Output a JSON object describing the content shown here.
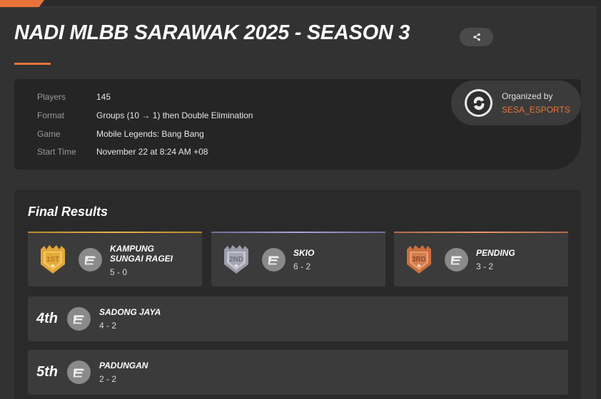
{
  "page": {
    "title": "NADI MLBB SARAWAK 2025 - SEASON 3",
    "share_icon": "share-icon"
  },
  "info": {
    "rows": [
      {
        "label": "Players",
        "value": "145"
      },
      {
        "label": "Format",
        "value": "Groups (10 → 1) then Double Elimination"
      },
      {
        "label": "Game",
        "value": "Mobile Legends: Bang Bang"
      },
      {
        "label": "Start Time",
        "value": "November 22 at 8:24 AM +08"
      }
    ]
  },
  "organizer": {
    "label": "Organized by",
    "name": "SESA_ESPORTS",
    "logo_icon": "sesa-esports-logo"
  },
  "results": {
    "heading": "Final Results",
    "podium": [
      {
        "place_badge": "1ST",
        "name_lines": [
          "KAMPUNG",
          "SUNGAI RAGEI"
        ],
        "score": "5 - 0",
        "accent": "#d9a23a"
      },
      {
        "place_badge": "2ND",
        "name_lines": [
          "SKIO"
        ],
        "score": "6 - 2",
        "accent": "#9a96c8"
      },
      {
        "place_badge": "3RD",
        "name_lines": [
          "PENDING"
        ],
        "score": "3 - 2",
        "accent": "#e08a5a"
      }
    ],
    "ranked": [
      {
        "rank": "4th",
        "name": "SADONG JAYA",
        "score": "4 - 2"
      },
      {
        "rank": "5th",
        "name": "PADUNGAN",
        "score": "2 - 2"
      }
    ]
  },
  "colors": {
    "accent": "#e8743b",
    "gold": "#e0a83a",
    "silver": "#a3a3b0",
    "bronze": "#d9824f",
    "background": "#323232",
    "panel": "#252525",
    "card": "#3b3b3b"
  }
}
